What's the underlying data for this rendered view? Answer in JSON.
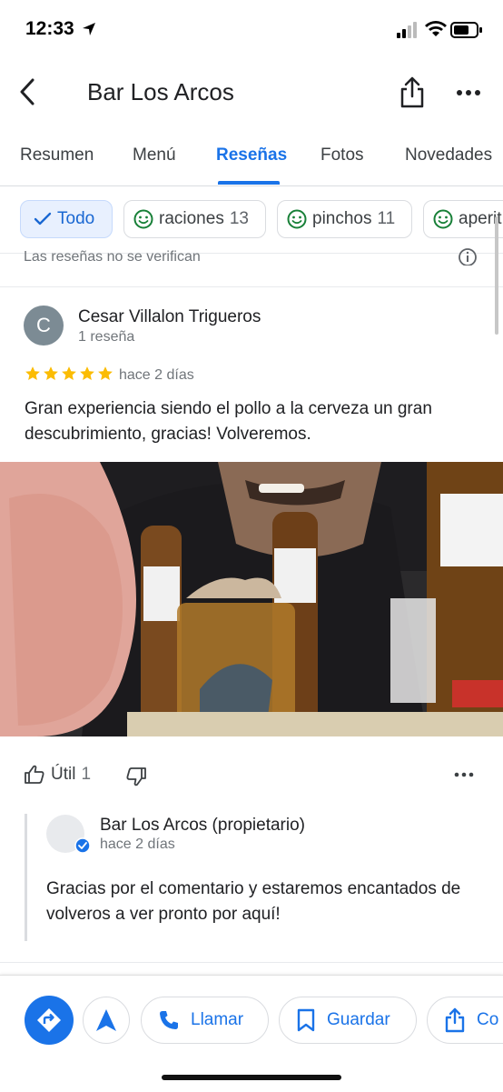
{
  "status": {
    "time": "12:33"
  },
  "header": {
    "title": "Bar Los Arcos"
  },
  "tabs": [
    {
      "label": "Resumen"
    },
    {
      "label": "Menú"
    },
    {
      "label": "Reseñas"
    },
    {
      "label": "Fotos"
    },
    {
      "label": "Novedades"
    }
  ],
  "chips": [
    {
      "label": "Todo"
    },
    {
      "label": "raciones",
      "count": "13"
    },
    {
      "label": "pinchos",
      "count": "11"
    },
    {
      "label": "aperit"
    }
  ],
  "notice": "Las reseñas no se verifican",
  "review": {
    "avatar_letter": "C",
    "author": "Cesar Villalon Trigueros",
    "author_meta": "1 reseña",
    "rating": 5,
    "time": "hace 2 días",
    "text": "Gran experiencia siendo el pollo a la cerveza un gran descubrimiento, gracias! Volveremos.",
    "useful_label": "Útil",
    "useful_count": "1"
  },
  "owner_reply": {
    "name": "Bar Los Arcos (propietario)",
    "time": "hace 2 días",
    "text": "Gracias por el comentario y estaremos encantados de volveros a ver pronto por aquí!"
  },
  "bottom_actions": {
    "call": "Llamar",
    "save": "Guardar",
    "share": "Co"
  },
  "colors": {
    "accent": "#1a73e8",
    "star": "#fbbc04",
    "chip_icon": "#188038"
  }
}
